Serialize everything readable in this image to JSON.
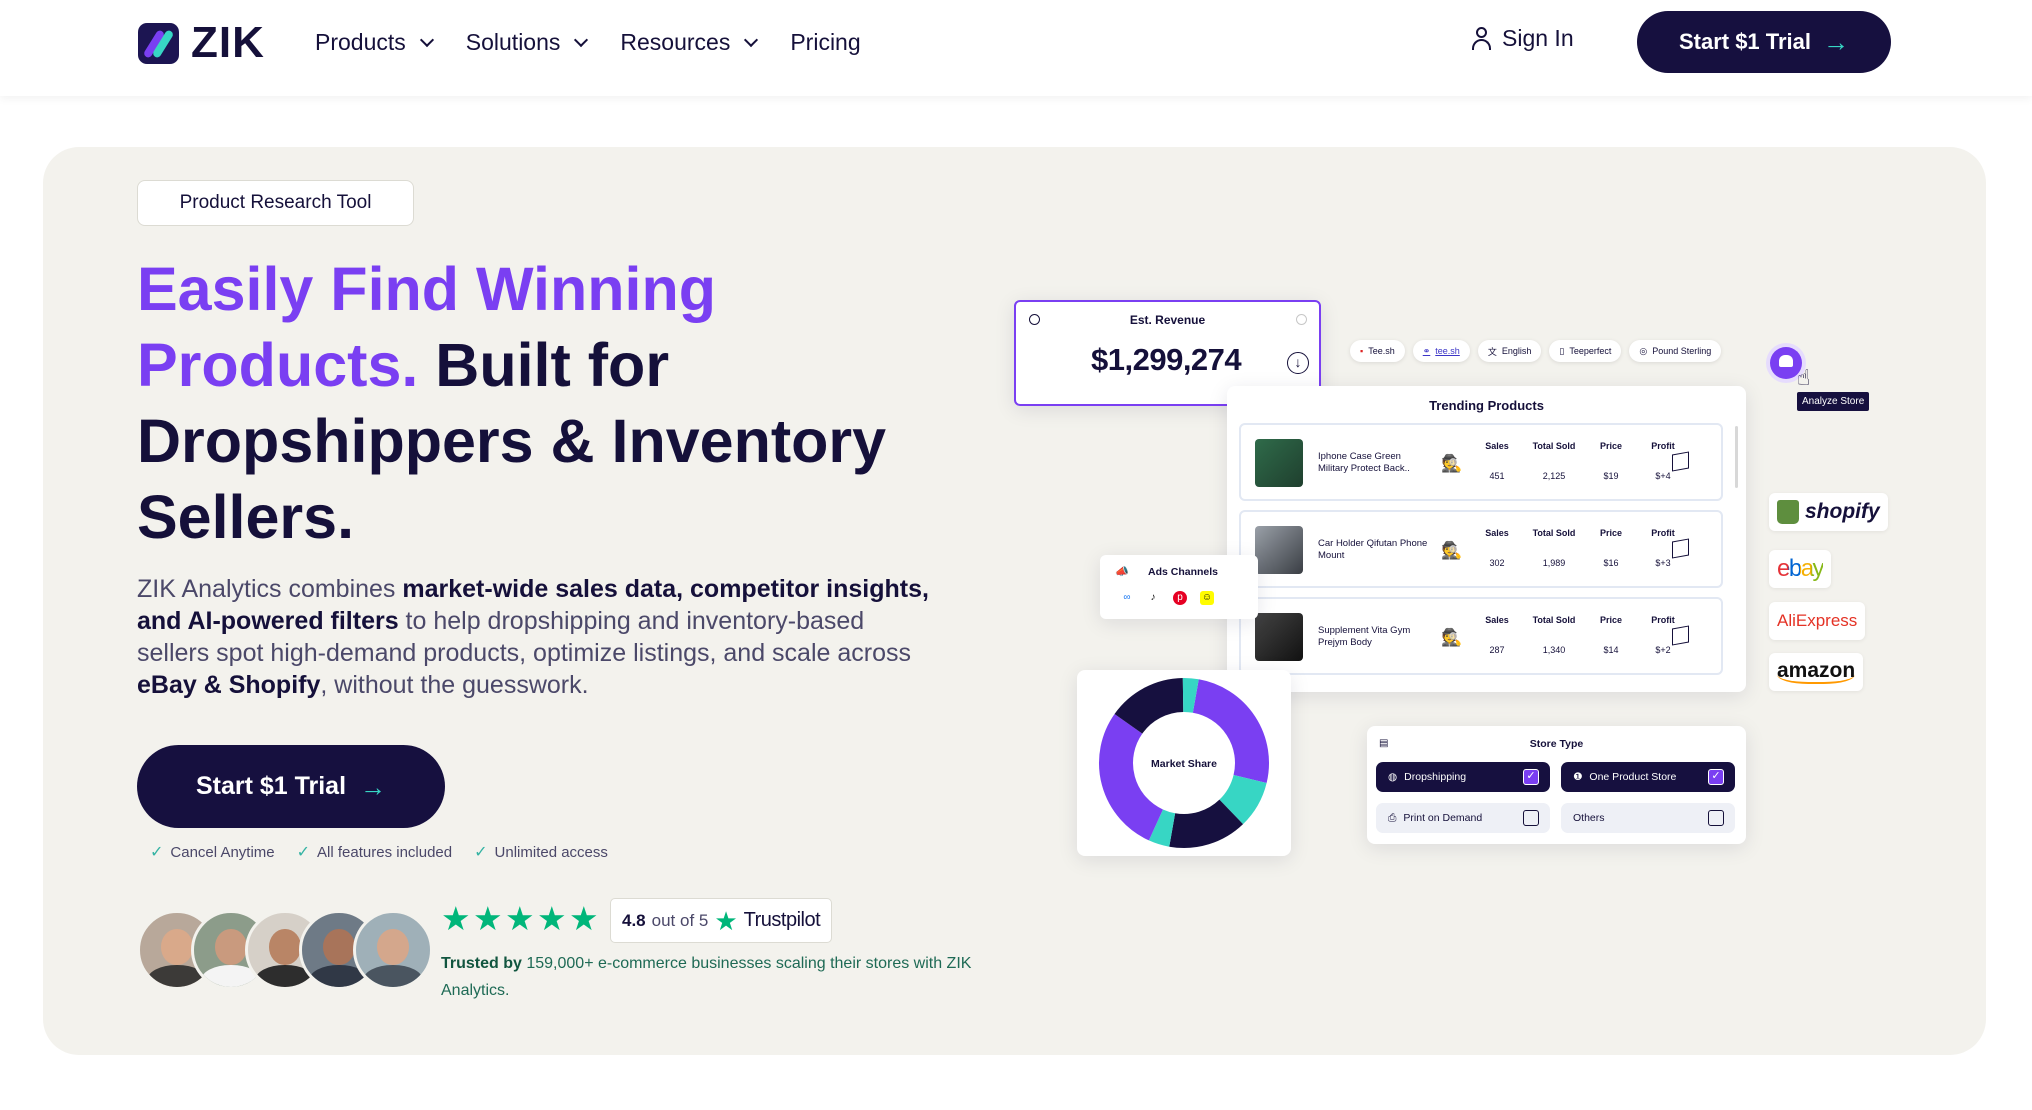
{
  "nav": {
    "logo_text": "ZIK",
    "menu": [
      {
        "label": "Products",
        "has_dropdown": true
      },
      {
        "label": "Solutions",
        "has_dropdown": true
      },
      {
        "label": "Resources",
        "has_dropdown": true
      },
      {
        "label": "Pricing",
        "has_dropdown": false
      }
    ],
    "signin": "Sign In",
    "cta": "Start $1 Trial"
  },
  "hero": {
    "tag": "Product Research Tool",
    "headline_highlight": "Easily Find Winning Products.",
    "headline_rest": " Built for Dropshippers & Inventory Sellers.",
    "desc": [
      {
        "t": "ZIK Analytics combines ",
        "b": false
      },
      {
        "t": "market-wide sales data, competitor insights, and AI-powered filters",
        "b": true
      },
      {
        "t": " to help dropshipping and inventory-based sellers spot high-demand products, optimize listings, and scale across ",
        "b": false
      },
      {
        "t": "eBay & Shopify",
        "b": true
      },
      {
        "t": ", without the guesswork.",
        "b": false
      }
    ],
    "cta": "Start $1 Trial",
    "features": [
      "Cancel Anytime",
      "All features included",
      "Unlimited access"
    ],
    "rating_score": "4.8",
    "rating_text": "out of 5",
    "rating_brand": "Trustpilot",
    "trust_bold": "Trusted by",
    "trust_text": " 159,000+ e-commerce businesses scaling their stores with ZIK Analytics."
  },
  "dashboard": {
    "revenue_label": "Est. Revenue",
    "revenue_value": "$1,299,274",
    "chips": [
      "Tee.sh",
      "tee.sh",
      "English",
      "Teeperfect",
      "Pound Sterling"
    ],
    "analyze_tooltip": "Analyze Store",
    "trending_title": "Trending Products",
    "col_labels": [
      "Sales",
      "Total Sold",
      "Price",
      "Profit"
    ],
    "products": [
      {
        "name": "Iphone Case Green Military Protect Back..",
        "sales": "451",
        "total_sold": "2,125",
        "price": "$19",
        "profit": "$+4"
      },
      {
        "name": "Car Holder Qifutan Phone Mount",
        "sales": "302",
        "total_sold": "1,989",
        "price": "$16",
        "profit": "$+3"
      },
      {
        "name": "Supplement Vita Gym Prejym Body",
        "sales": "287",
        "total_sold": "1,340",
        "price": "$14",
        "profit": "$+2"
      }
    ],
    "ads_title": "Ads Channels",
    "market_share_label": "Market Share",
    "market_share": [
      {
        "fraction": 0.26,
        "color": "#7a3ff2"
      },
      {
        "fraction": 0.09,
        "color": "#37d6c4"
      },
      {
        "fraction": 0.15,
        "color": "#16103f"
      },
      {
        "fraction": 0.04,
        "color": "#37d6c4"
      },
      {
        "fraction": 0.28,
        "color": "#7a3ff2"
      },
      {
        "fraction": 0.15,
        "color": "#16103f"
      },
      {
        "fraction": 0.03,
        "color": "#37d6c4"
      }
    ],
    "store_type_title": "Store Type",
    "store_types": [
      {
        "label": "Dropshipping",
        "checked": true
      },
      {
        "label": "One Product Store",
        "checked": true
      },
      {
        "label": "Print on Demand",
        "checked": false
      },
      {
        "label": "Others",
        "checked": false
      }
    ],
    "brands": [
      "shopify",
      "ebay",
      "AliExpress",
      "amazon"
    ]
  },
  "colors": {
    "accent": "#7a3ff2",
    "navy": "#16103f",
    "teal": "#37d6c4",
    "trust_green": "#00b67a"
  },
  "icons": [
    "chevron-down-icon",
    "user-icon",
    "arrow-right-icon",
    "check-icon",
    "star-icon"
  ]
}
